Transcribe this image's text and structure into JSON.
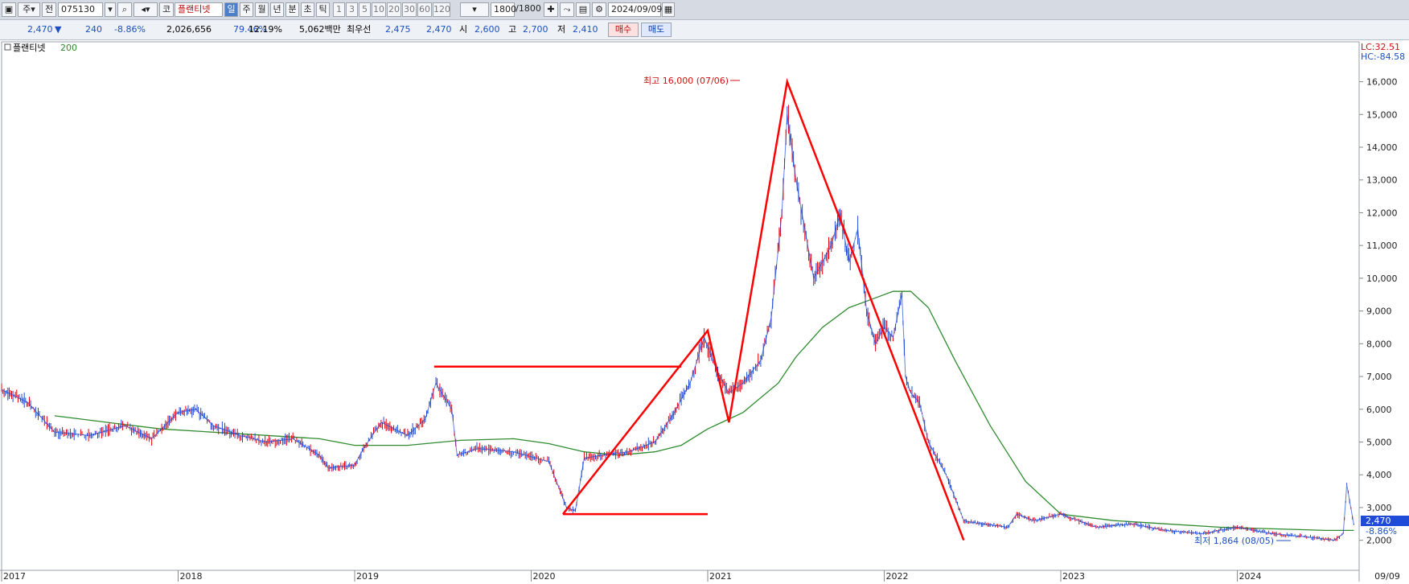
{
  "toolbar": {
    "type_label": "주",
    "prev_label": "전",
    "code": "075130",
    "market_label": "코",
    "stock_name": "플랜티넷",
    "periods": [
      {
        "label": "일",
        "active": true
      },
      {
        "label": "주",
        "active": false
      },
      {
        "label": "월",
        "active": false
      },
      {
        "label": "년",
        "active": false
      },
      {
        "label": "분",
        "active": false
      },
      {
        "label": "초",
        "active": false
      },
      {
        "label": "틱",
        "active": false
      }
    ],
    "intervals": [
      "1",
      "3",
      "5",
      "10",
      "20",
      "30",
      "60",
      "120"
    ],
    "count": "1800",
    "count_total": "/1800",
    "date": "2024/09/09"
  },
  "quote": {
    "price": "2,470",
    "direction_symbol": "▼",
    "change": "240",
    "change_pct": "-8.86%",
    "volume": "2,026,656",
    "turnover_ratio": "79.46%",
    "ratio2": "12.19%",
    "amount": "5,062백만",
    "best_label": "최우선",
    "best_ask": "2,475",
    "best_bid": "2,470",
    "open_label": "시",
    "open": "2,600",
    "high_label": "고",
    "high": "2,700",
    "low_label": "저",
    "low": "2,410",
    "buy_label": "매수",
    "sell_label": "매도"
  },
  "legend": {
    "name": "플랜티넷",
    "ma": "200"
  },
  "right_labels": {
    "lc": "LC:32.51",
    "hc": "HC:-84.58",
    "current": "2,470",
    "current_pct": "-8.86%"
  },
  "annotations": {
    "high": "최고 16,000 (07/06)",
    "low": "최저 1,864 (08/05)"
  },
  "colors": {
    "up": "#e8000b",
    "down": "#1f4bd8",
    "ma": "#2e8b2e",
    "drawing": "#ff0000",
    "toolbar_bg": "#d6dbe3"
  },
  "chart_data": {
    "type": "line",
    "title": "",
    "xlabel": "",
    "ylabel": "",
    "ylim": [
      1500,
      16800
    ],
    "x_ticks": [
      "2017",
      "2018",
      "2019",
      "2020",
      "2021",
      "2022",
      "2023",
      "2024",
      "09/09"
    ],
    "y_ticks": [
      "2,000",
      "3,000",
      "4,000",
      "5,000",
      "6,000",
      "7,000",
      "8,000",
      "9,000",
      "10,000",
      "11,000",
      "12,000",
      "13,000",
      "14,000",
      "15,000",
      "16,000"
    ],
    "series": [
      {
        "name": "플랜티넷",
        "x": [
          2017.0,
          2017.15,
          2017.3,
          2017.5,
          2017.7,
          2017.85,
          2018.0,
          2018.1,
          2018.2,
          2018.35,
          2018.5,
          2018.65,
          2018.8,
          2018.85,
          2019.0,
          2019.05,
          2019.15,
          2019.3,
          2019.4,
          2019.46,
          2019.55,
          2019.58,
          2019.7,
          2019.9,
          2020.1,
          2020.2,
          2020.25,
          2020.3,
          2020.4,
          2020.55,
          2020.7,
          2020.8,
          2020.9,
          2020.98,
          2021.05,
          2021.12,
          2021.2,
          2021.3,
          2021.36,
          2021.42,
          2021.45,
          2021.5,
          2021.55,
          2021.6,
          2021.7,
          2021.75,
          2021.8,
          2021.85,
          2021.9,
          2021.95,
          2022.0,
          2022.05,
          2022.1,
          2022.12,
          2022.15,
          2022.2,
          2022.25,
          2022.35,
          2022.45,
          2022.55,
          2022.7,
          2022.75,
          2022.85,
          2023.0,
          2023.2,
          2023.4,
          2023.6,
          2023.8,
          2024.0,
          2024.2,
          2024.4,
          2024.55,
          2024.6,
          2024.62,
          2024.66
        ],
        "y": [
          6600,
          6200,
          5300,
          5200,
          5500,
          5100,
          5900,
          6000,
          5500,
          5200,
          5000,
          5100,
          4600,
          4200,
          4300,
          4800,
          5600,
          5200,
          5700,
          6800,
          6000,
          4600,
          4800,
          4700,
          4400,
          3000,
          2900,
          4500,
          4600,
          4700,
          5000,
          5800,
          6800,
          8200,
          7200,
          6500,
          6800,
          7500,
          8800,
          12000,
          15000,
          13000,
          11500,
          10000,
          11000,
          12000,
          10500,
          11500,
          9000,
          8000,
          8500,
          8200,
          9500,
          7000,
          6500,
          6200,
          5000,
          4000,
          2600,
          2500,
          2400,
          2800,
          2600,
          2800,
          2400,
          2500,
          2300,
          2200,
          2400,
          2200,
          2100,
          2000,
          2200,
          3700,
          2470
        ]
      },
      {
        "name": "200",
        "x": [
          2017.3,
          2017.6,
          2017.9,
          2018.2,
          2018.5,
          2018.8,
          2019.0,
          2019.3,
          2019.6,
          2019.9,
          2020.1,
          2020.3,
          2020.5,
          2020.7,
          2020.85,
          2021.0,
          2021.2,
          2021.4,
          2021.5,
          2021.65,
          2021.8,
          2021.95,
          2022.05,
          2022.15,
          2022.25,
          2022.4,
          2022.6,
          2022.8,
          2023.0,
          2023.3,
          2023.6,
          2023.9,
          2024.2,
          2024.5,
          2024.66
        ],
        "y": [
          5800,
          5600,
          5400,
          5300,
          5200,
          5100,
          4900,
          4900,
          5050,
          5100,
          4950,
          4700,
          4600,
          4700,
          4900,
          5400,
          5900,
          6800,
          7600,
          8500,
          9100,
          9400,
          9600,
          9600,
          9100,
          7500,
          5500,
          3800,
          2800,
          2600,
          2500,
          2400,
          2350,
          2300,
          2300
        ]
      }
    ],
    "drawings": [
      {
        "x": [
          2019.45,
          2020.85
        ],
        "y": [
          7300,
          7300
        ]
      },
      {
        "x": [
          2020.18,
          2021.0
        ],
        "y": [
          2800,
          2800
        ]
      },
      {
        "x": [
          2020.18,
          2021.0,
          2021.12,
          2021.45,
          2022.45
        ],
        "y": [
          2800,
          8400,
          5600,
          16000,
          2000
        ]
      }
    ]
  }
}
